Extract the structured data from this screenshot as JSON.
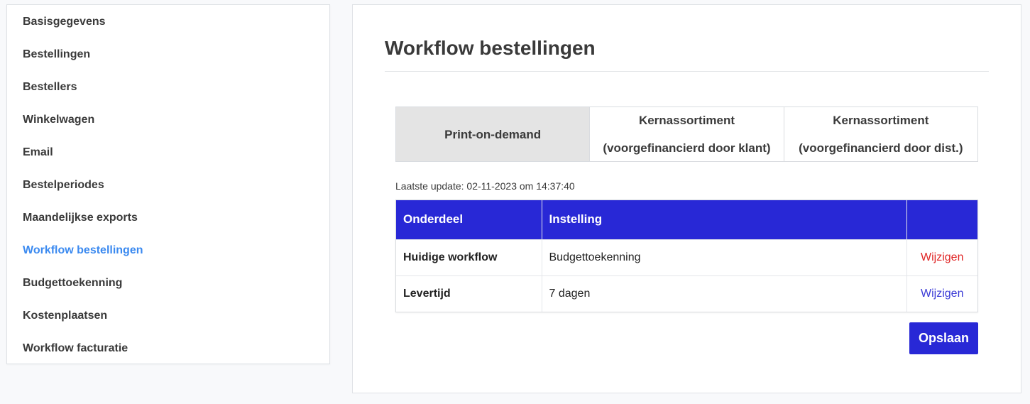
{
  "sidebar": {
    "items": [
      {
        "label": "Basisgegevens"
      },
      {
        "label": "Bestellingen"
      },
      {
        "label": "Bestellers"
      },
      {
        "label": "Winkelwagen"
      },
      {
        "label": "Email"
      },
      {
        "label": "Bestelperiodes"
      },
      {
        "label": "Maandelijkse exports"
      },
      {
        "label": "Workflow bestellingen",
        "active": true
      },
      {
        "label": "Budgettoekenning"
      },
      {
        "label": "Kostenplaatsen"
      },
      {
        "label": "Workflow facturatie"
      }
    ]
  },
  "main": {
    "title": "Workflow bestellingen",
    "tabs": [
      {
        "line1": "Print-on-demand",
        "line2": "",
        "active": true
      },
      {
        "line1": "Kernassortiment",
        "line2": "(voorgefinancierd door klant)"
      },
      {
        "line1": "Kernassortiment",
        "line2": "(voorgefinancierd door dist.)"
      }
    ],
    "last_update": "Laatste update: 02-11-2023 om 14:37:40",
    "table": {
      "headers": [
        "Onderdeel",
        "Instelling",
        ""
      ],
      "rows": [
        {
          "onderdeel": "Huidige workflow",
          "instelling": "Budgettoekenning",
          "action": "Wijzigen",
          "action_color": "#e02525"
        },
        {
          "onderdeel": "Levertijd",
          "instelling": "7 dagen",
          "action": "Wijzigen",
          "action_color": "#3a3ad6"
        }
      ]
    },
    "save_label": "Opslaan"
  },
  "colors": {
    "accent": "#2828d6",
    "active_link": "#3b8af0",
    "danger": "#e02525"
  }
}
